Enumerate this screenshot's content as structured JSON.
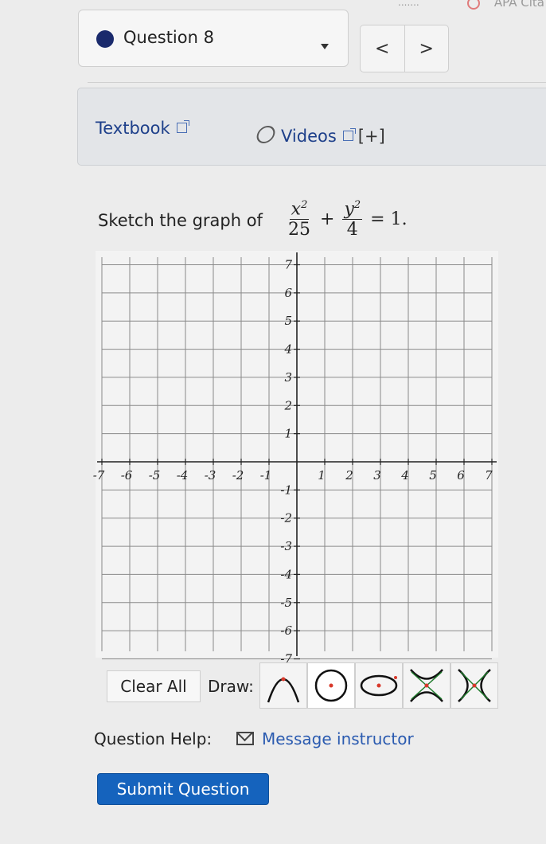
{
  "topbar": {
    "citation_label": "APA Cita"
  },
  "question": {
    "label": "Question 8"
  },
  "nav": {
    "prev": "<",
    "next": ">"
  },
  "resources": {
    "textbook": "Textbook",
    "videos": "Videos",
    "expand": "[+]"
  },
  "prompt": {
    "text": "Sketch the graph of",
    "eq_num1": "x",
    "eq_den1": "25",
    "eq_plus": "+",
    "eq_num2": "y",
    "eq_den2": "4",
    "eq_rhs": "= 1.",
    "exponent": "2"
  },
  "graph": {
    "x_ticks": [
      "-7",
      "-6",
      "-5",
      "-4",
      "-3",
      "-2",
      "-1",
      "1",
      "2",
      "3",
      "4",
      "5",
      "6",
      "7"
    ],
    "y_ticks": [
      "7",
      "6",
      "5",
      "4",
      "3",
      "2",
      "1",
      "-1",
      "-2",
      "-3",
      "-4",
      "-5",
      "-6",
      "-7"
    ]
  },
  "tools": {
    "clear_label": "Clear All",
    "draw_label": "Draw:",
    "items": [
      "parabola-tool",
      "circle-tool",
      "ellipse-tool",
      "hyperbola-vertical-tool",
      "hyperbola-horizontal-tool"
    ]
  },
  "help": {
    "label": "Question Help:",
    "message": "Message instructor"
  },
  "submit": {
    "label": "Submit Question"
  },
  "colors": {
    "accent": "#1563bd",
    "link": "#1d3f8a",
    "tool_point": "#d8392b"
  }
}
